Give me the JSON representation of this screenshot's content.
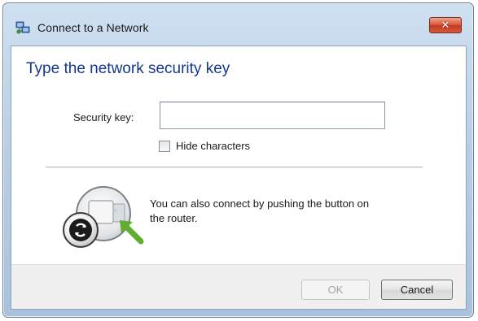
{
  "window": {
    "title": "Connect to a Network",
    "close_label": "✕"
  },
  "main": {
    "heading": "Type the network security key",
    "security_key_label": "Security key:",
    "security_key_value": "",
    "hide_characters_label": "Hide characters",
    "hide_characters_checked": false,
    "wps_text": "You can also connect by pushing the button on the router."
  },
  "footer": {
    "ok_label": "OK",
    "cancel_label": "Cancel"
  },
  "colors": {
    "heading": "#16378e",
    "close_button": "#c23a20",
    "arrow": "#5fae2e"
  },
  "icons": {
    "title": "network-icon",
    "close": "close-icon",
    "router": "router-wps-button-icon"
  }
}
